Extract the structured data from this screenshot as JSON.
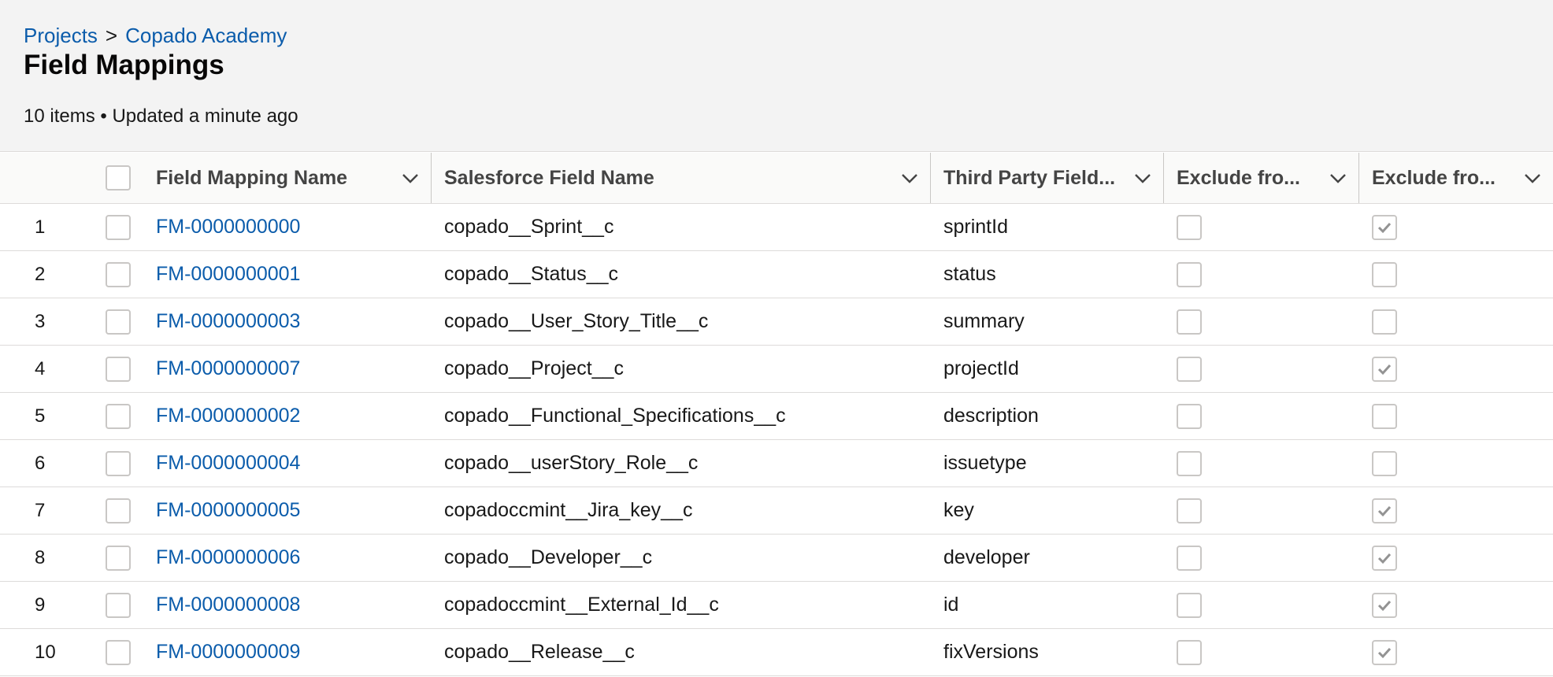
{
  "breadcrumb": {
    "parent": "Projects",
    "separator": ">",
    "current": "Copado Academy"
  },
  "page": {
    "title": "Field Mappings",
    "meta": "10 items • Updated a minute ago"
  },
  "columns": {
    "name": "Field Mapping Name",
    "sf": "Salesforce Field Name",
    "tp": "Third Party Field...",
    "ex1": "Exclude fro...",
    "ex2": "Exclude fro..."
  },
  "rows": [
    {
      "num": "1",
      "name": "FM-0000000000",
      "sf": "copado__Sprint__c",
      "tp": "sprintId",
      "ex1": false,
      "ex2": true
    },
    {
      "num": "2",
      "name": "FM-0000000001",
      "sf": "copado__Status__c",
      "tp": "status",
      "ex1": false,
      "ex2": false
    },
    {
      "num": "3",
      "name": "FM-0000000003",
      "sf": "copado__User_Story_Title__c",
      "tp": "summary",
      "ex1": false,
      "ex2": false
    },
    {
      "num": "4",
      "name": "FM-0000000007",
      "sf": "copado__Project__c",
      "tp": "projectId",
      "ex1": false,
      "ex2": true
    },
    {
      "num": "5",
      "name": "FM-0000000002",
      "sf": "copado__Functional_Specifications__c",
      "tp": "description",
      "ex1": false,
      "ex2": false
    },
    {
      "num": "6",
      "name": "FM-0000000004",
      "sf": "copado__userStory_Role__c",
      "tp": "issuetype",
      "ex1": false,
      "ex2": false
    },
    {
      "num": "7",
      "name": "FM-0000000005",
      "sf": "copadoccmint__Jira_key__c",
      "tp": "key",
      "ex1": false,
      "ex2": true
    },
    {
      "num": "8",
      "name": "FM-0000000006",
      "sf": "copado__Developer__c",
      "tp": "developer",
      "ex1": false,
      "ex2": true
    },
    {
      "num": "9",
      "name": "FM-0000000008",
      "sf": "copadoccmint__External_Id__c",
      "tp": "id",
      "ex1": false,
      "ex2": true
    },
    {
      "num": "10",
      "name": "FM-0000000009",
      "sf": "copado__Release__c",
      "tp": "fixVersions",
      "ex1": false,
      "ex2": true
    }
  ]
}
